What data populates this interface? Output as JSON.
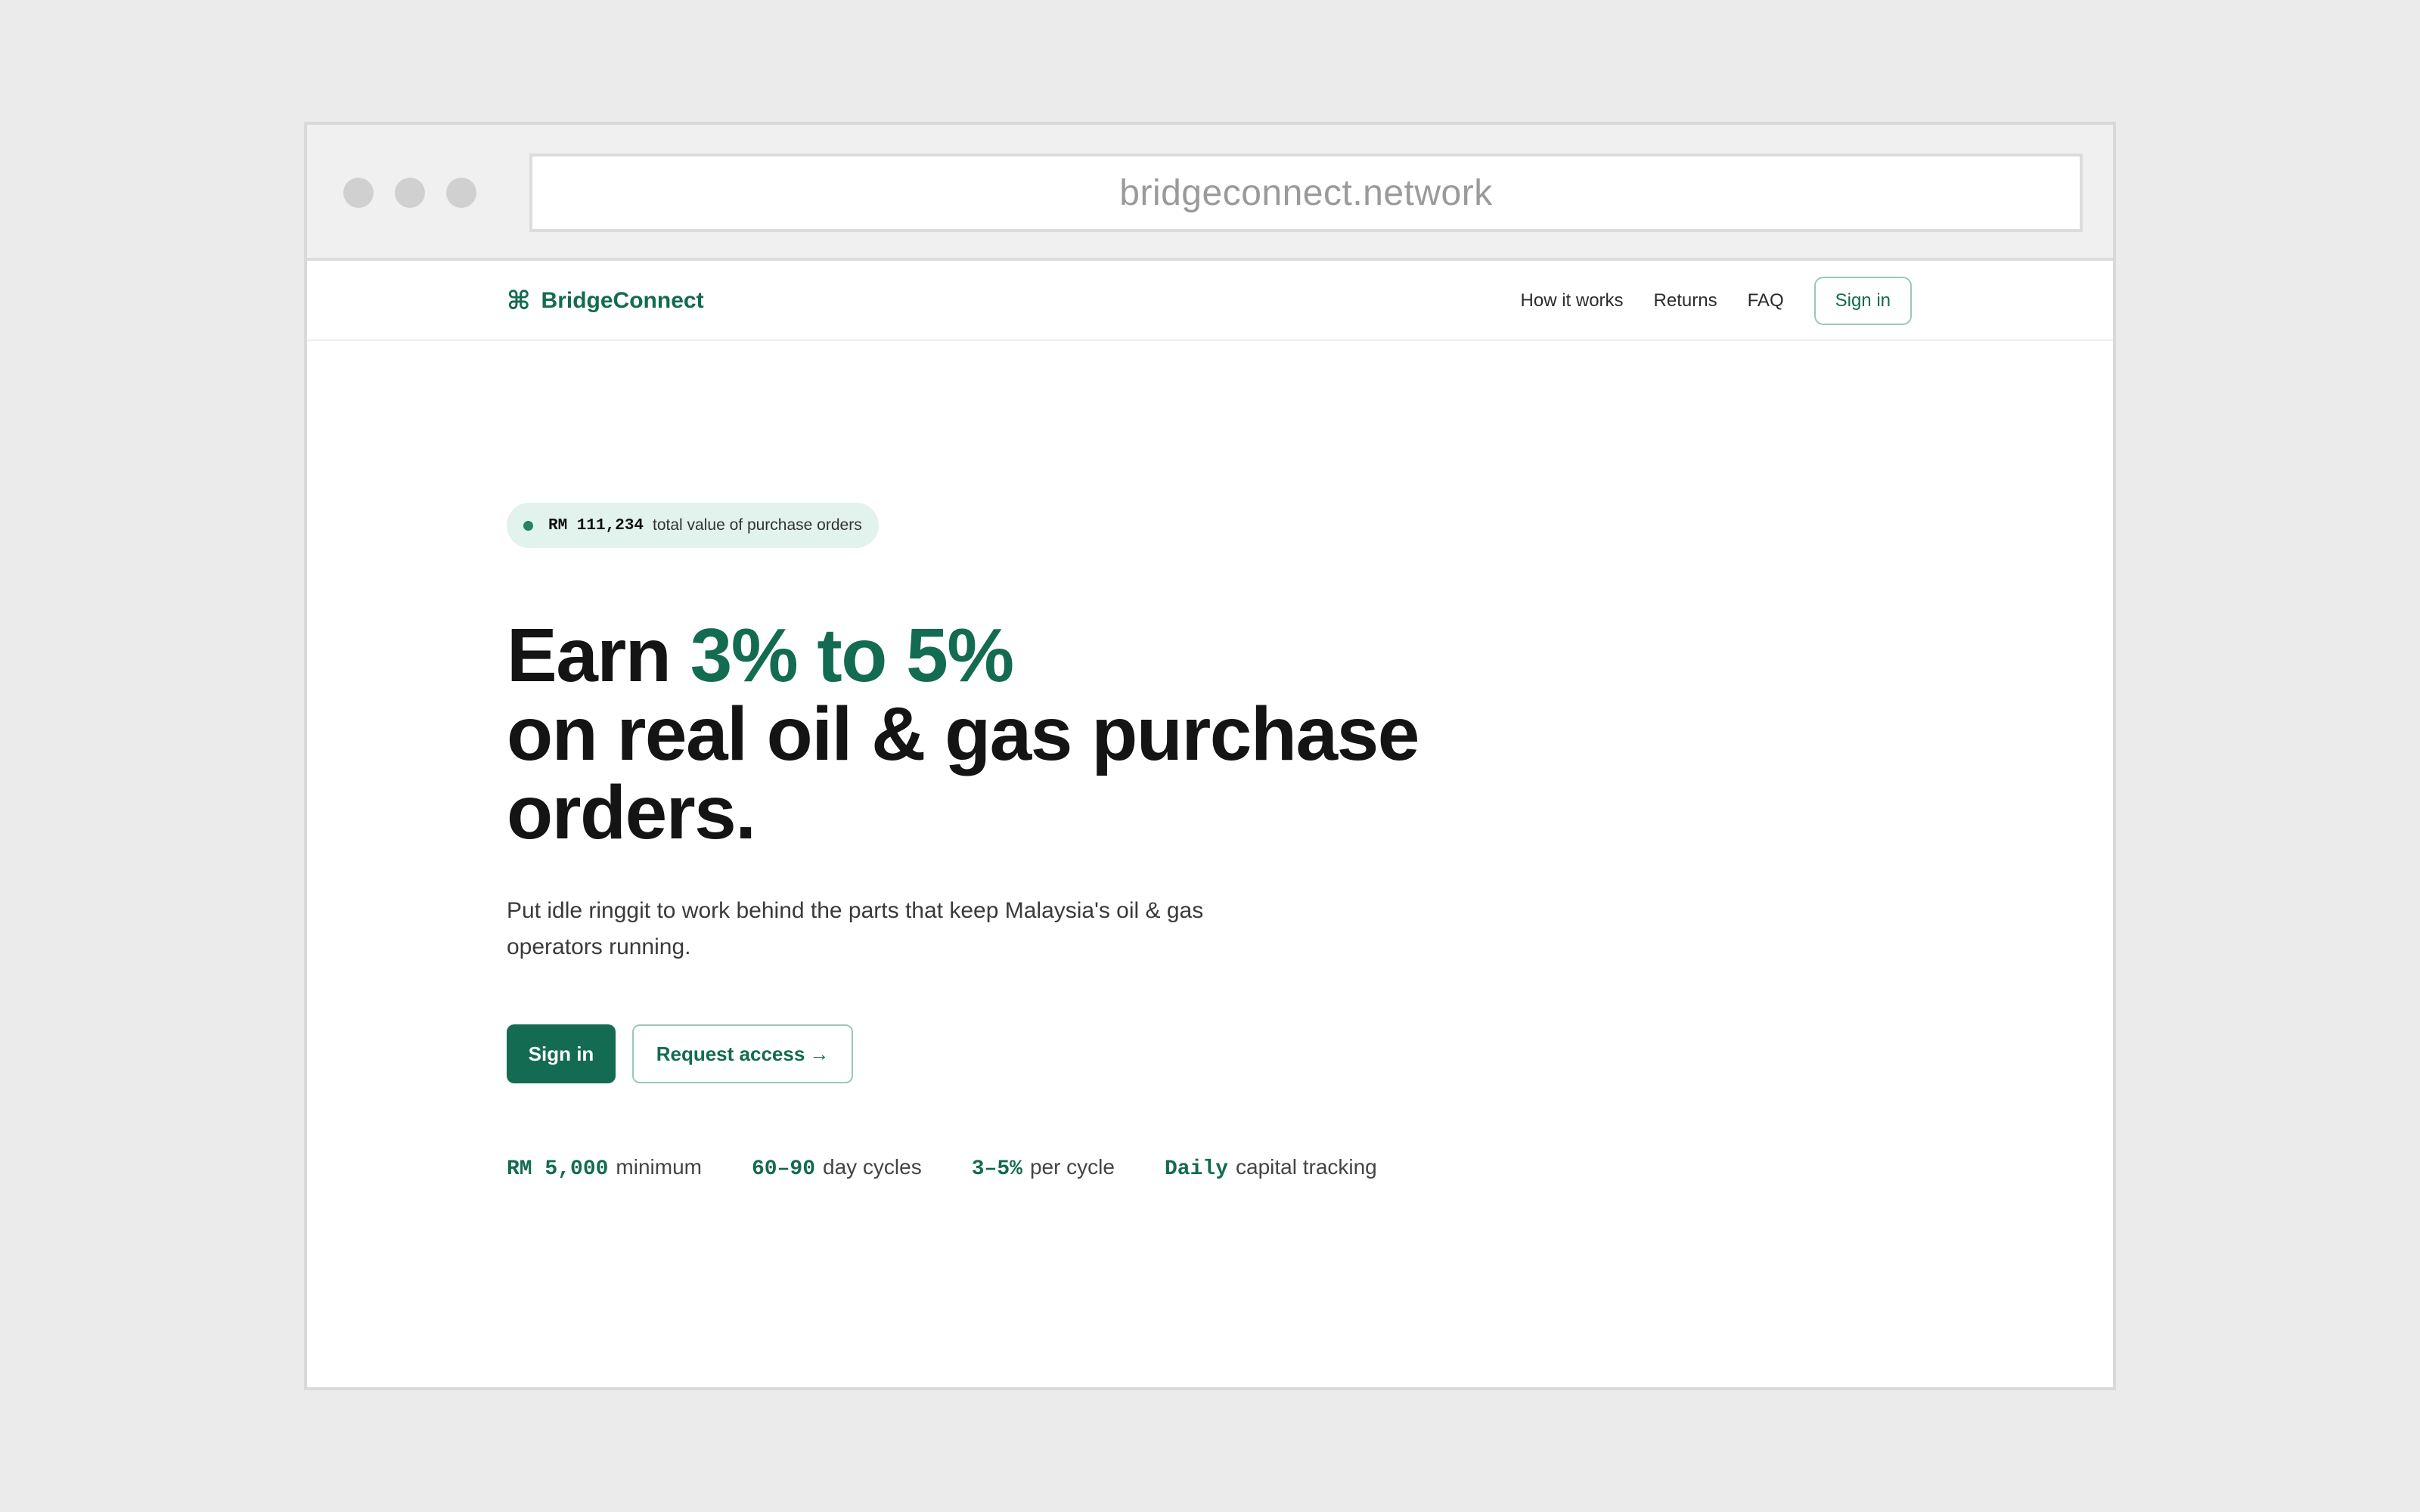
{
  "browser": {
    "url": "bridgeconnect.network"
  },
  "nav": {
    "brand_icon": "command-icon",
    "brand_name": "BridgeConnect",
    "links": [
      "How it works",
      "Returns",
      "FAQ"
    ],
    "signin_label": "Sign in"
  },
  "hero": {
    "badge_amount": "RM 111,234",
    "badge_text": "total value of purchase orders",
    "headline_prefix": "Earn ",
    "headline_accent": "3% to 5%",
    "headline_line2": "on real oil & gas purchase",
    "headline_line3": "orders.",
    "subtitle": "Put idle ringgit to work behind the parts that keep Malaysia's oil & gas operators running.",
    "primary_button": "Sign in",
    "secondary_button": "Request access",
    "secondary_arrow": "→"
  },
  "stats": [
    {
      "key": "RM 5,000",
      "label": "minimum"
    },
    {
      "key": "60–90",
      "label": "day cycles"
    },
    {
      "key": "3–5%",
      "label": "per cycle"
    },
    {
      "key": "Daily",
      "label": "capital tracking"
    }
  ],
  "colors": {
    "accent": "#136b51",
    "badge_bg": "#e2f2ec",
    "text": "#141414"
  }
}
